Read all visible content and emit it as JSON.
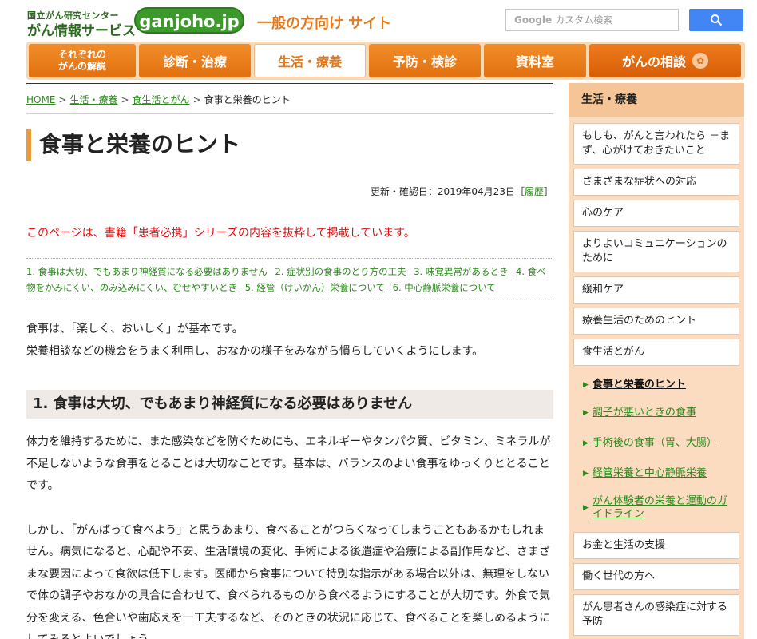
{
  "header": {
    "org_small": "国立がん研究センター",
    "org_big": "がん情報サービス",
    "domain": "ganjoho.jp",
    "site_label": "一般の方向け サイト",
    "search_placeholder": "カスタム検索",
    "search_brand": "Google"
  },
  "nav": {
    "items": [
      {
        "label": "それぞれの\nがんの解説"
      },
      {
        "label": "診断・治療"
      },
      {
        "label": "生活・療養"
      },
      {
        "label": "予防・検診"
      },
      {
        "label": "資料室"
      },
      {
        "label": "がんの相談"
      }
    ]
  },
  "breadcrumb": {
    "home": "HOME",
    "level1": "生活・療養",
    "level2": "食生活とがん",
    "current": "食事と栄養のヒント"
  },
  "page": {
    "title": "食事と栄養のヒント",
    "updated_label": "更新・確認日：2019年04月23日［",
    "history_link": "履歴",
    "updated_close": "］",
    "notice": "このページは、書籍「患者必携」シリーズの内容を抜粋して掲載しています。",
    "toc": [
      "1. 食事は大切、でもあまり神経質になる必要はありません",
      "2. 症状別の食事のとり方の工夫",
      "3. 味覚異常があるとき",
      "4. 食べ物をかみにくい、のみ込みにくい、むせやすいとき",
      "5. 経管（けいかん）栄養について",
      "6. 中心静脈栄養について"
    ],
    "intro_1": "食事は、「楽しく、おいしく」が基本です。",
    "intro_2": "栄養相談などの機会をうまく利用し、おなかの様子をみながら慣らしていくようにします。",
    "section1_title": "1. 食事は大切、でもあまり神経質になる必要はありません",
    "section1_p1": "体力を維持するために、また感染などを防ぐためにも、エネルギーやタンパク質、ビタミン、ミネラルが不足しないような食事をとることは大切なことです。基本は、バランスのよい食事をゆっくりととることです。",
    "section1_p2": "しかし、「がんばって食べよう」と思うあまり、食べることがつらくなってしまうこともあるかもしれません。病気になると、心配や不安、生活環境の変化、手術による後遺症や治療による副作用など、さまざまな要因によって食欲は低下します。医師から食事について特別な指示がある場合以外は、無理をしないで体の調子やおなかの具合に合わせて、食べられるものから食べるようにすることが大切です。外食で気分を変える、色合いや歯応えを一工夫するなど、そのときの状況に応じて、食べることを楽しめるようにしてみるとよいでしょう。"
  },
  "sidebar": {
    "title": "生活・療養",
    "items": [
      "もしも、がんと言われたら －まず、心がけておきたいこと",
      "さまざまな症状への対応",
      "心のケア",
      "よりよいコミュニケーションのために",
      "緩和ケア",
      "療養生活のためのヒント",
      "食生活とがん"
    ],
    "subitems": [
      "食事と栄養のヒント",
      "調子が悪いときの食事",
      "手術後の食事（胃、大腸）",
      "経管栄養と中心静脈栄養",
      "がん体験者の栄養と運動のガイドライン"
    ],
    "items_after": [
      "お金と生活の支援",
      "働く世代の方へ",
      "がん患者さんの感染症に対する予防"
    ]
  }
}
